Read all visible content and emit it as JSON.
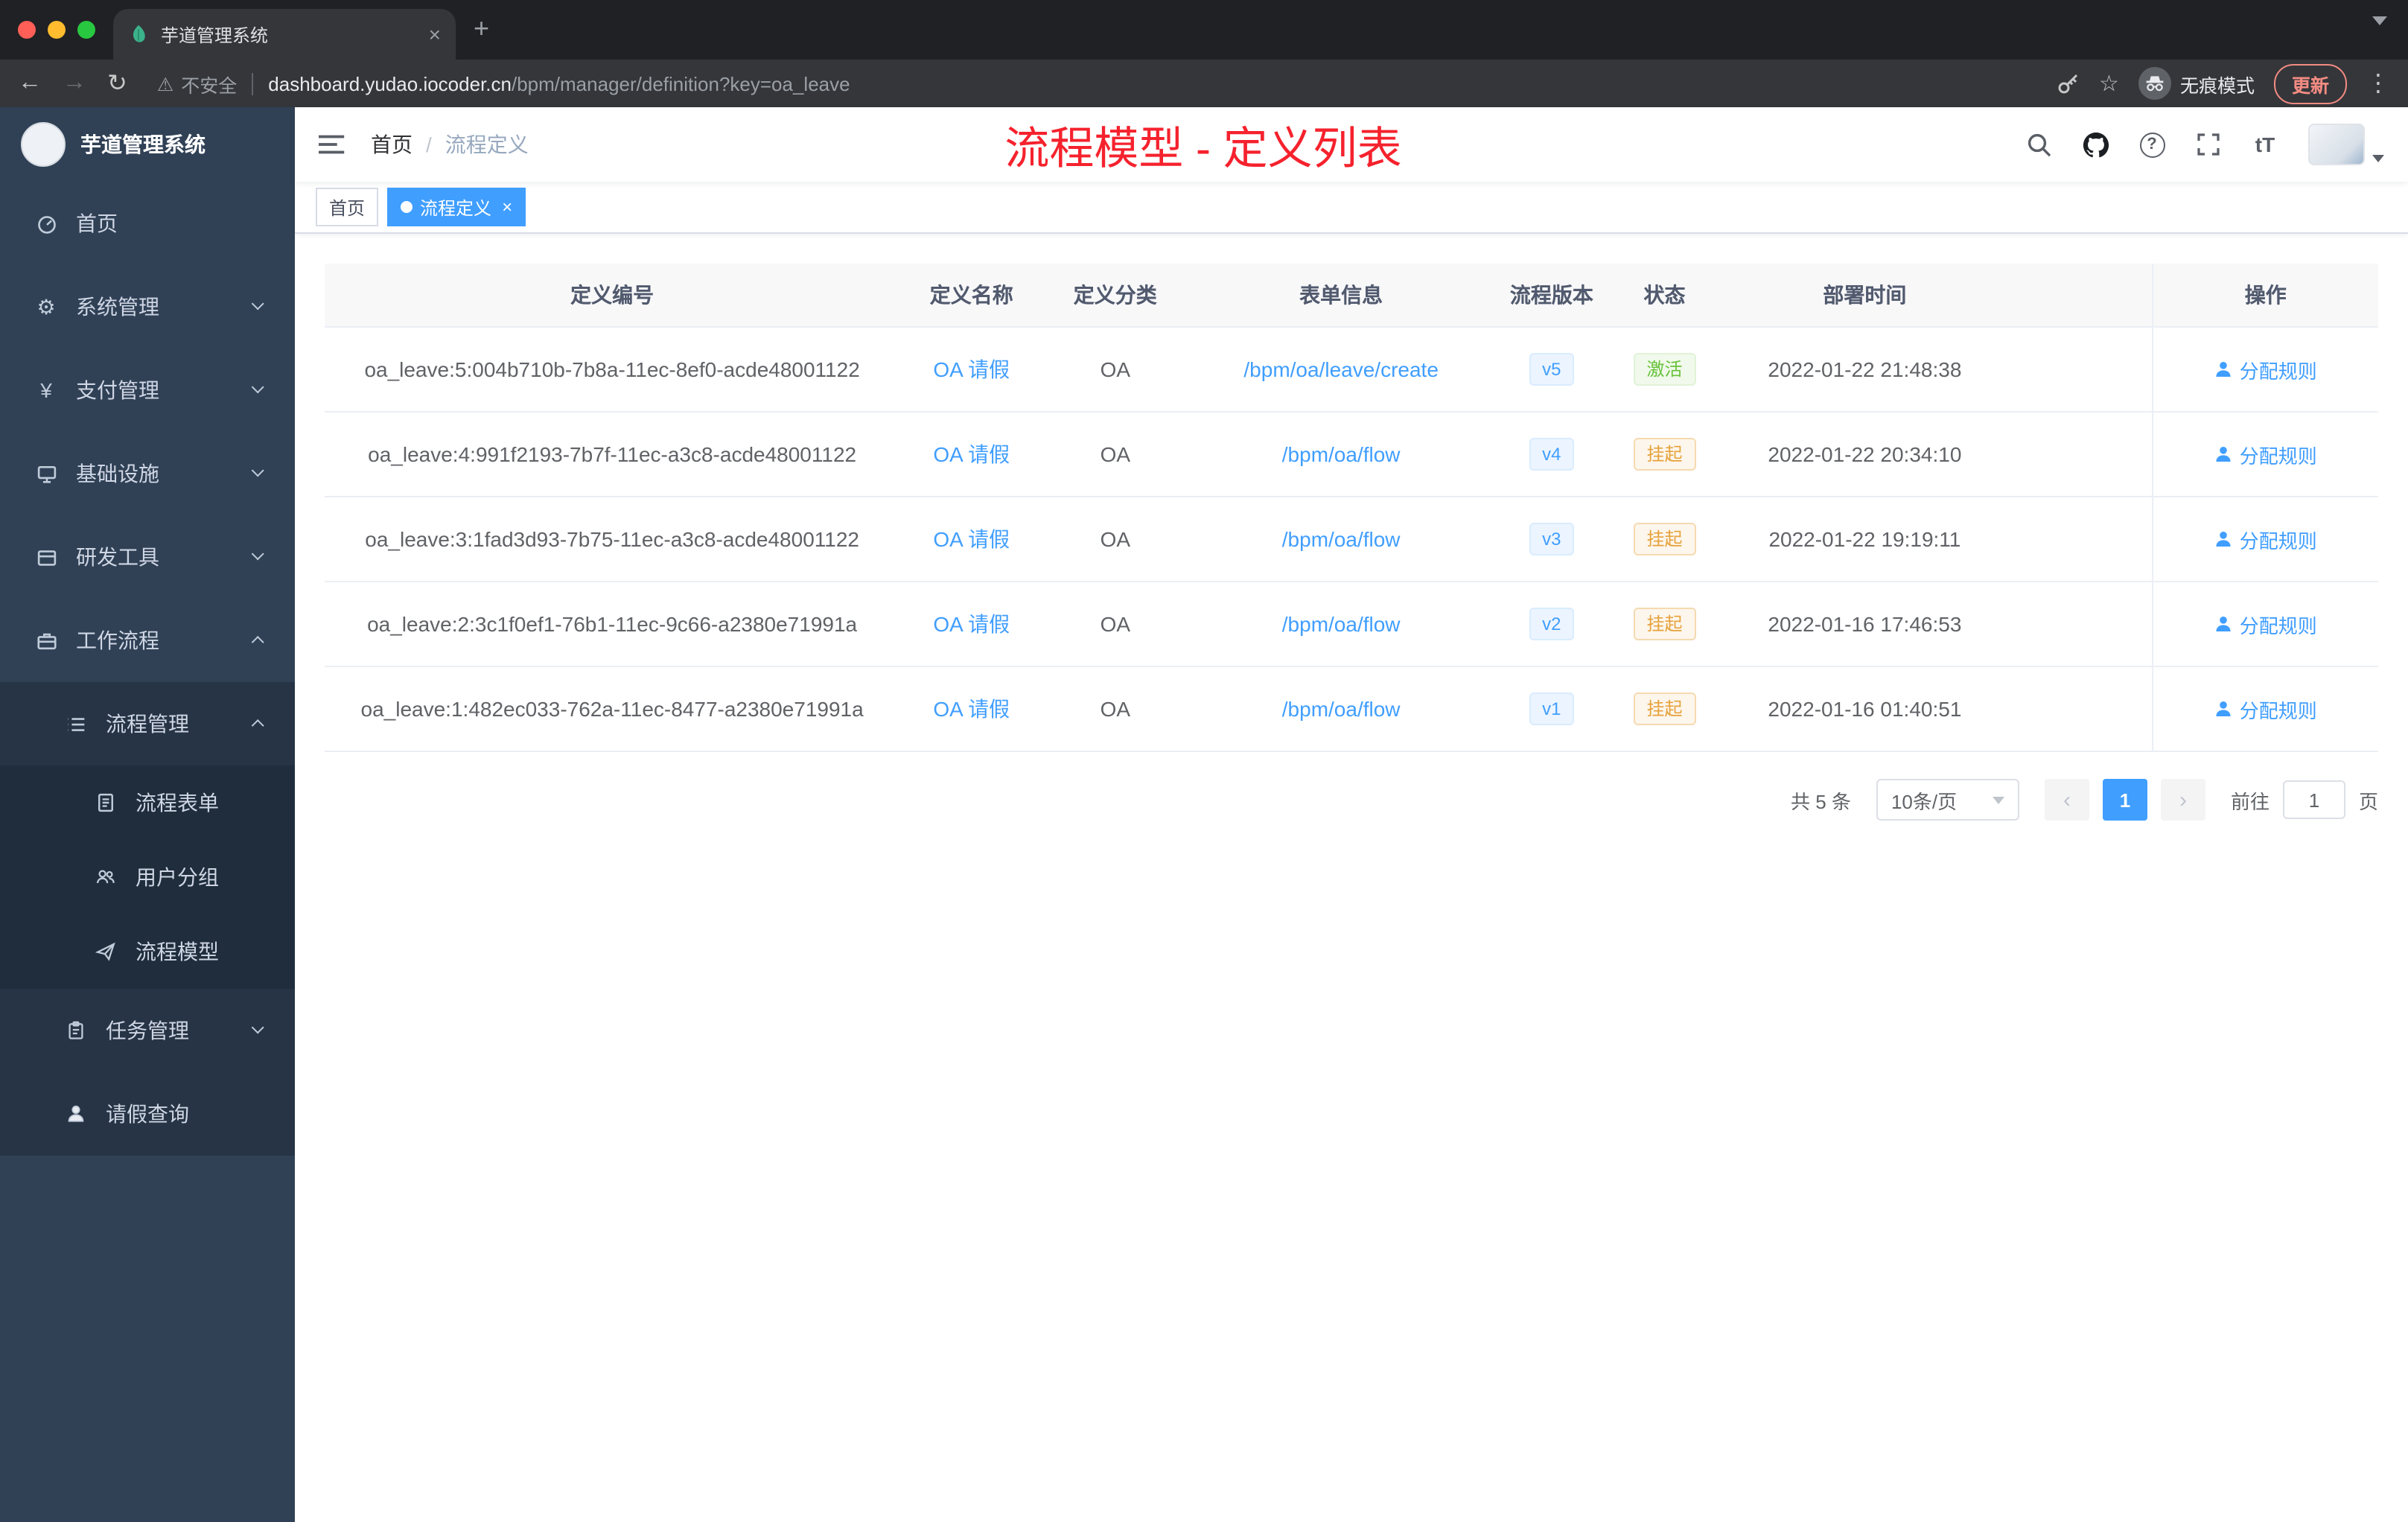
{
  "icons": {
    "back": "←",
    "forward": "→",
    "reload": "↻",
    "warning": "⚠",
    "star": "☆",
    "more": "⋮",
    "plus": "+",
    "tab_close": "×",
    "tag_close": "×",
    "help": "?",
    "font_size": "tT",
    "gear": "⚙",
    "yen": "¥",
    "prev": "‹",
    "next": "›"
  },
  "browser": {
    "tab_title": "芋道管理系统",
    "security_label": "不安全",
    "url_domain": "dashboard.yudao.iocoder.cn",
    "url_path": "/bpm/manager/definition?key=oa_leave",
    "incognito_label": "无痕模式",
    "update_label": "更新"
  },
  "sidebar": {
    "brand": "芋道管理系统",
    "items": [
      {
        "label": "首页"
      },
      {
        "label": "系统管理"
      },
      {
        "label": "支付管理"
      },
      {
        "label": "基础设施"
      },
      {
        "label": "研发工具"
      },
      {
        "label": "工作流程"
      },
      {
        "label": "流程管理"
      },
      {
        "label": "流程表单"
      },
      {
        "label": "用户分组"
      },
      {
        "label": "流程模型"
      },
      {
        "label": "任务管理"
      },
      {
        "label": "请假查询"
      }
    ]
  },
  "header": {
    "breadcrumb_home": "首页",
    "breadcrumb_current": "流程定义",
    "overlay_title": "流程模型 - 定义列表"
  },
  "tags_view": {
    "home": "首页",
    "active": "流程定义"
  },
  "table": {
    "columns": [
      "定义编号",
      "定义名称",
      "定义分类",
      "表单信息",
      "流程版本",
      "状态",
      "部署时间",
      "操作"
    ],
    "rows": [
      {
        "id": "oa_leave:5:004b710b-7b8a-11ec-8ef0-acde48001122",
        "name": "OA 请假",
        "category": "OA",
        "form": "/bpm/oa/leave/create",
        "version": "v5",
        "status": "激活",
        "time": "2022-01-22 21:48:38",
        "action": "分配规则"
      },
      {
        "id": "oa_leave:4:991f2193-7b7f-11ec-a3c8-acde48001122",
        "name": "OA 请假",
        "category": "OA",
        "form": "/bpm/oa/flow",
        "version": "v4",
        "status": "挂起",
        "time": "2022-01-22 20:34:10",
        "action": "分配规则"
      },
      {
        "id": "oa_leave:3:1fad3d93-7b75-11ec-a3c8-acde48001122",
        "name": "OA 请假",
        "category": "OA",
        "form": "/bpm/oa/flow",
        "version": "v3",
        "status": "挂起",
        "time": "2022-01-22 19:19:11",
        "action": "分配规则"
      },
      {
        "id": "oa_leave:2:3c1f0ef1-76b1-11ec-9c66-a2380e71991a",
        "name": "OA 请假",
        "category": "OA",
        "form": "/bpm/oa/flow",
        "version": "v2",
        "status": "挂起",
        "time": "2022-01-16 17:46:53",
        "action": "分配规则"
      },
      {
        "id": "oa_leave:1:482ec033-762a-11ec-8477-a2380e71991a",
        "name": "OA 请假",
        "category": "OA",
        "form": "/bpm/oa/flow",
        "version": "v1",
        "status": "挂起",
        "time": "2022-01-16 01:40:51",
        "action": "分配规则"
      }
    ]
  },
  "pagination": {
    "total": "共 5 条",
    "page_size": "10条/页",
    "current_page": "1",
    "goto_prefix": "前往",
    "goto_value": "1",
    "goto_suffix": "页"
  }
}
